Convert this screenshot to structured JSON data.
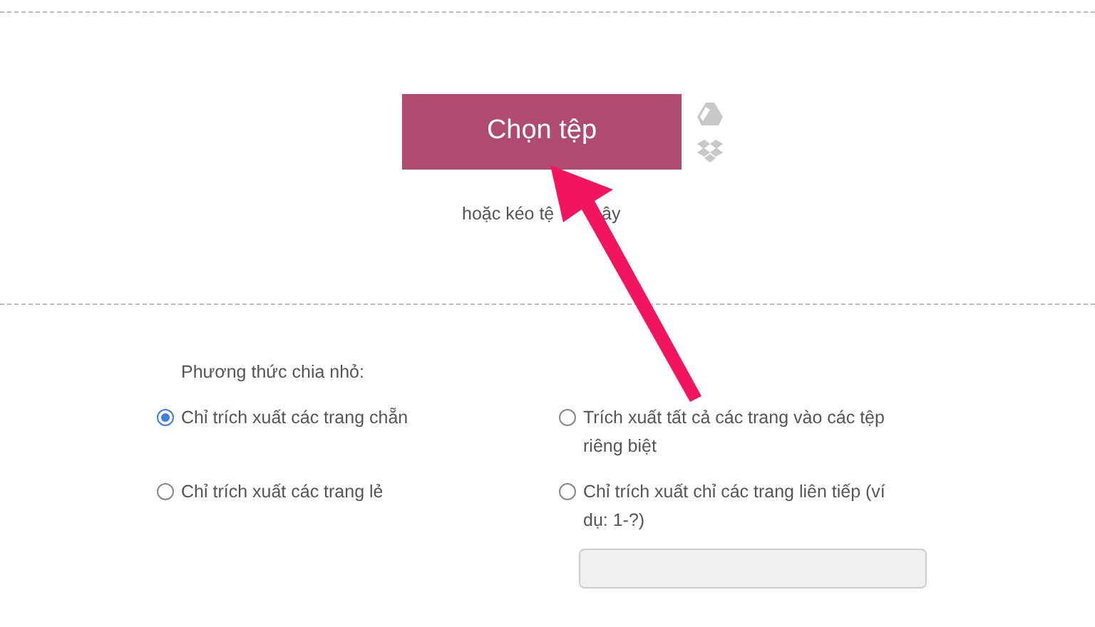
{
  "upload": {
    "button": "Chọn tệp",
    "hint_parts": [
      "hoặc kéo tệ",
      "ây"
    ]
  },
  "split": {
    "label": "Phương thức chia nhỏ:",
    "options": [
      {
        "label": "Chỉ trích xuất các trang chẵn",
        "selected": true
      },
      {
        "label": "Trích xuất tất cả các trang vào các tệp riêng biệt",
        "selected": false
      },
      {
        "label": "Chỉ trích xuất các trang lẻ",
        "selected": false
      },
      {
        "label": "Chỉ trích xuất chỉ các trang liên tiếp (ví dụ: 1-?)",
        "selected": false
      }
    ]
  }
}
